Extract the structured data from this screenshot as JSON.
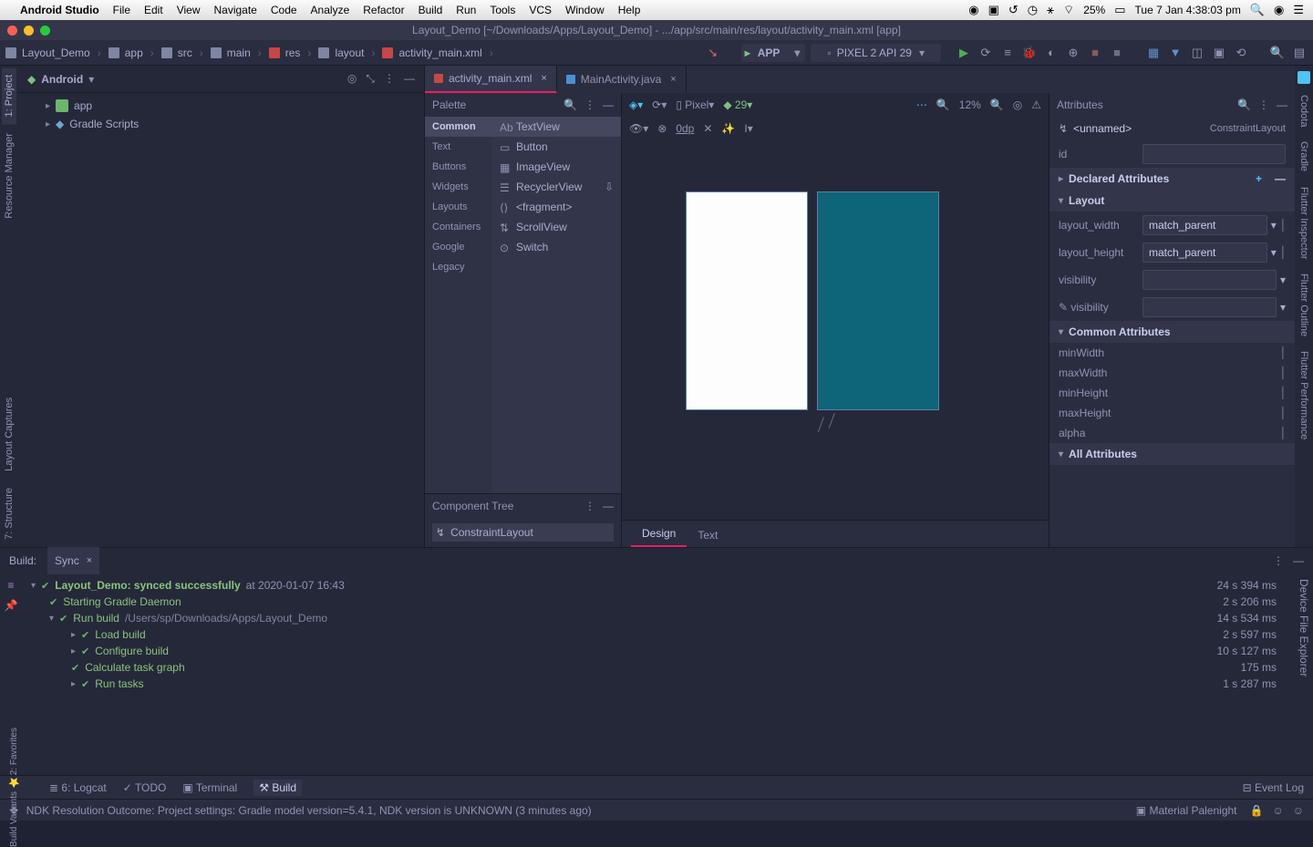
{
  "menubar": {
    "app": "Android Studio",
    "items": [
      "File",
      "Edit",
      "View",
      "Navigate",
      "Code",
      "Analyze",
      "Refactor",
      "Build",
      "Run",
      "Tools",
      "VCS",
      "Window",
      "Help"
    ],
    "battery": "25%",
    "clock": "Tue 7 Jan  4:38:03 pm"
  },
  "window": {
    "title": "Layout_Demo [~/Downloads/Apps/Layout_Demo] - .../app/src/main/res/layout/activity_main.xml [app]"
  },
  "breadcrumbs": [
    "Layout_Demo",
    "app",
    "src",
    "main",
    "res",
    "layout",
    "activity_main.xml"
  ],
  "runconfig": {
    "app": "APP",
    "device": "PIXEL 2 API 29"
  },
  "project": {
    "title": "Android",
    "tree": [
      {
        "label": "app",
        "kind": "module"
      },
      {
        "label": "Gradle Scripts",
        "kind": "scripts"
      }
    ]
  },
  "leftGutter": [
    "1: Project",
    "Resource Manager",
    "Layout Captures",
    "7: Structure"
  ],
  "rightGutter": [
    "Codota",
    "Gradle",
    "Flutter Inspector",
    "Flutter Outline",
    "Flutter Performance"
  ],
  "tabs": [
    {
      "label": "activity_main.xml",
      "active": true,
      "kind": "xml"
    },
    {
      "label": "MainActivity.java",
      "active": false,
      "kind": "java"
    }
  ],
  "palette": {
    "title": "Palette",
    "categories": [
      "Common",
      "Text",
      "Buttons",
      "Widgets",
      "Layouts",
      "Containers",
      "Google",
      "Legacy"
    ],
    "selectedCat": "Common",
    "widgets": [
      "TextView",
      "Button",
      "ImageView",
      "RecyclerView",
      "<fragment>",
      "ScrollView",
      "Switch"
    ]
  },
  "componentTree": {
    "title": "Component Tree",
    "root": "ConstraintLayout"
  },
  "canvas": {
    "device": "Pixel",
    "api": "29",
    "zoom": "12%",
    "autoconnect": "0dp"
  },
  "designTabs": [
    "Design",
    "Text"
  ],
  "attributes": {
    "title": "Attributes",
    "selected": {
      "name": "<unnamed>",
      "type": "ConstraintLayout"
    },
    "id": "",
    "sections": {
      "declared": "Declared Attributes",
      "layout": "Layout",
      "common": "Common Attributes",
      "all": "All Attributes"
    },
    "layout_width": "match_parent",
    "layout_height": "match_parent",
    "visibility": "",
    "visibility2": "",
    "commonAttrs": [
      "minWidth",
      "maxWidth",
      "minHeight",
      "maxHeight",
      "alpha"
    ]
  },
  "build": {
    "title": "Build:",
    "tab": "Sync",
    "rows": [
      {
        "indent": 0,
        "chev": "▾",
        "ok": true,
        "label": "Layout_Demo: synced successfully",
        "ts": "at 2020-01-07 16:43",
        "timing": "24 s 394 ms"
      },
      {
        "indent": 1,
        "ok": true,
        "label": "Starting Gradle Daemon",
        "timing": "2 s 206 ms"
      },
      {
        "indent": 1,
        "chev": "▾",
        "ok": true,
        "label": "Run build",
        "path": "/Users/sp/Downloads/Apps/Layout_Demo",
        "timing": "14 s 534 ms"
      },
      {
        "indent": 2,
        "chev": "▸",
        "ok": true,
        "label": "Load build",
        "timing": "2 s 597 ms"
      },
      {
        "indent": 2,
        "chev": "▸",
        "ok": true,
        "label": "Configure build",
        "timing": "10 s 127 ms"
      },
      {
        "indent": 2,
        "ok": true,
        "label": "Calculate task graph",
        "timing": "175 ms"
      },
      {
        "indent": 2,
        "chev": "▸",
        "ok": true,
        "label": "Run tasks",
        "timing": "1 s 287 ms"
      }
    ]
  },
  "bottomTabs": [
    "6: Logcat",
    "TODO",
    "Terminal",
    "Build"
  ],
  "eventLog": "Event Log",
  "status": {
    "msg": "NDK Resolution Outcome: Project settings: Gradle model version=5.4.1, NDK version is UNKNOWN (3 minutes ago)",
    "theme": "Material Palenight"
  }
}
